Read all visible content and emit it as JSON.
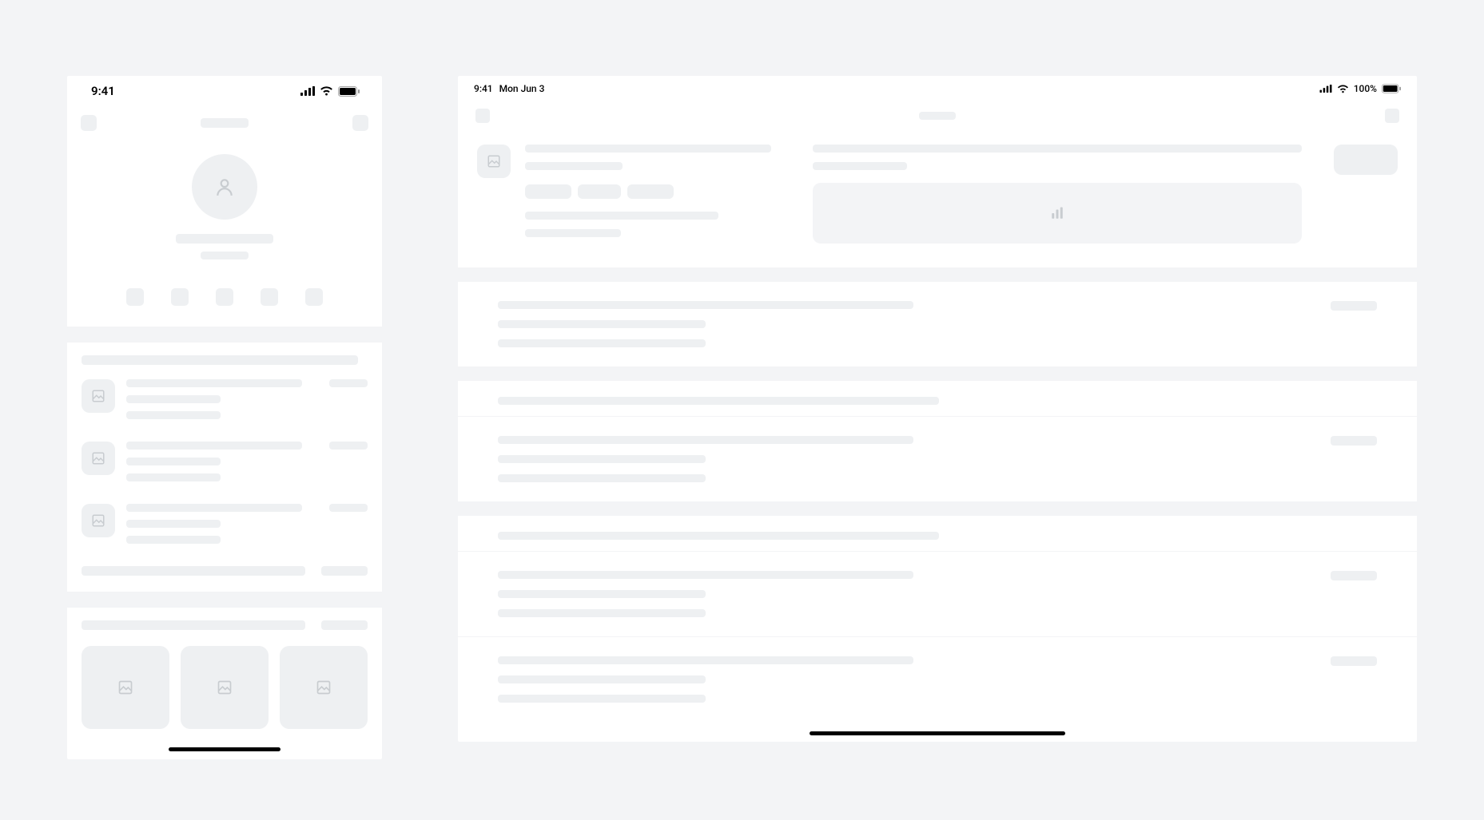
{
  "phone": {
    "status": {
      "time": "9:41"
    },
    "icons": {
      "avatar": "person-icon",
      "thumb": "image-icon"
    }
  },
  "tablet": {
    "status": {
      "time": "9:41",
      "date": "Mon Jun 3",
      "battery": "100%"
    },
    "icons": {
      "chart": "bar-chart-icon",
      "thumb": "image-icon"
    }
  }
}
